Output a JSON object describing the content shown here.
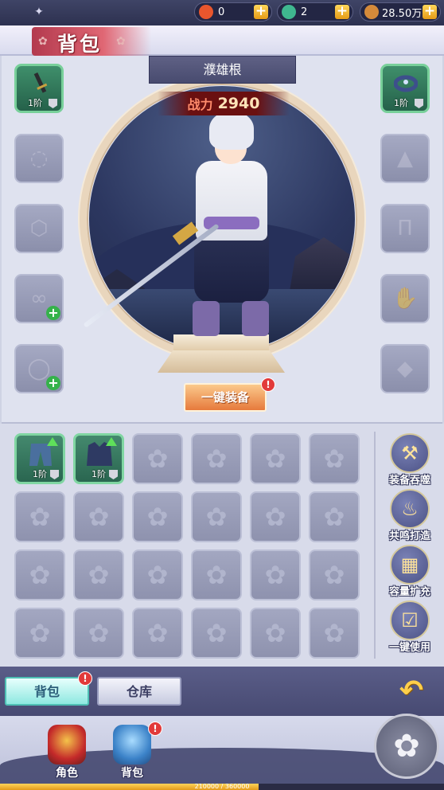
{
  "currency": [
    {
      "value": "0",
      "color": "#e8562d"
    },
    {
      "value": "2",
      "color": "#3fb78f"
    },
    {
      "value": "28.50万",
      "color": "#d58a3a"
    }
  ],
  "title": "背包",
  "character": {
    "name": "濮雄根",
    "power_label": "战力",
    "power_value": "2940"
  },
  "equipment_slots": {
    "left": [
      {
        "filled": true,
        "icon": "katana-icon",
        "tier": "1阶"
      },
      {
        "filled": false,
        "icon": "necklace-icon"
      },
      {
        "filled": false,
        "icon": "amulet-icon"
      },
      {
        "filled": false,
        "icon": "bracelet-icon",
        "can_add": true
      },
      {
        "filled": false,
        "icon": "ring-icon",
        "can_add": true
      }
    ],
    "right": [
      {
        "filled": true,
        "icon": "headband-icon",
        "tier": "1阶"
      },
      {
        "filled": false,
        "icon": "robe-icon"
      },
      {
        "filled": false,
        "icon": "pants-icon"
      },
      {
        "filled": false,
        "icon": "glove-icon"
      },
      {
        "filled": false,
        "icon": "shoe-icon"
      }
    ]
  },
  "equip_all_label": "一键装备",
  "bag_items": [
    {
      "name": "pants",
      "tier": "1阶",
      "upgrade": true
    },
    {
      "name": "coat",
      "tier": "1阶",
      "upgrade": true
    }
  ],
  "side_actions": [
    {
      "label": "装备吞噬",
      "icon": "devour-icon"
    },
    {
      "label": "共鸣打造",
      "icon": "forge-icon"
    },
    {
      "label": "容量扩充",
      "icon": "expand-icon"
    },
    {
      "label": "一键使用",
      "icon": "use-all-icon"
    }
  ],
  "tabs": {
    "bag": "背包",
    "warehouse": "仓库"
  },
  "bottom_nav": [
    {
      "label": "角色",
      "icon": "character-icon"
    },
    {
      "label": "背包",
      "icon": "bag-icon"
    }
  ],
  "xp": {
    "text": "210000 / 360000",
    "fraction": 0.583
  },
  "alert_mark": "!"
}
